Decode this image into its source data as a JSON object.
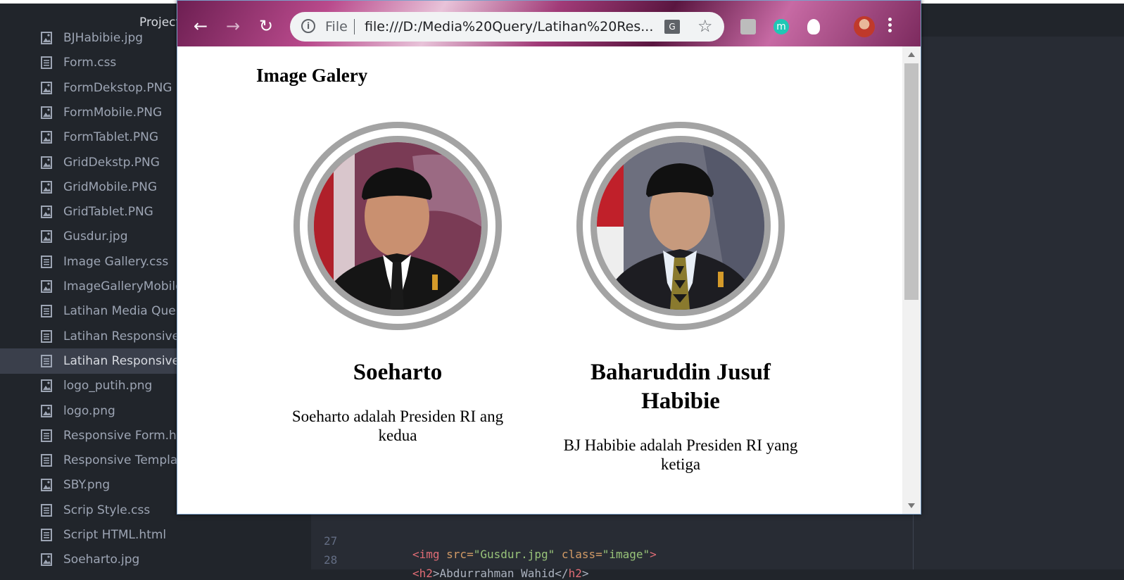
{
  "editor": {
    "tree_title": "Project",
    "files": [
      {
        "name": "BJHabibie.jpg",
        "type": "image"
      },
      {
        "name": "Form.css",
        "type": "file"
      },
      {
        "name": "FormDekstop.PNG",
        "type": "image"
      },
      {
        "name": "FormMobile.PNG",
        "type": "image"
      },
      {
        "name": "FormTablet.PNG",
        "type": "image"
      },
      {
        "name": "GridDekstp.PNG",
        "type": "image"
      },
      {
        "name": "GridMobile.PNG",
        "type": "image"
      },
      {
        "name": "GridTablet.PNG",
        "type": "image"
      },
      {
        "name": "Gusdur.jpg",
        "type": "image"
      },
      {
        "name": "Image Gallery.css",
        "type": "file"
      },
      {
        "name": "ImageGalleryMobile.",
        "type": "image"
      },
      {
        "name": "Latihan Media Query",
        "type": "file"
      },
      {
        "name": "Latihan Responsive A",
        "type": "file"
      },
      {
        "name": "Latihan Responsive In",
        "type": "file",
        "selected": true
      },
      {
        "name": "logo_putih.png",
        "type": "image"
      },
      {
        "name": "logo.png",
        "type": "image"
      },
      {
        "name": "Responsive Form.htm",
        "type": "file"
      },
      {
        "name": "Responsive Template",
        "type": "file"
      },
      {
        "name": "SBY.png",
        "type": "image"
      },
      {
        "name": "Scrip Style.css",
        "type": "file"
      },
      {
        "name": "Script HTML.html",
        "type": "file"
      },
      {
        "name": "Soeharto.jpg",
        "type": "image"
      }
    ],
    "code_lines": [
      {
        "num": "27",
        "tag_open": "<img",
        "attr1": " src=",
        "val1": "\"Gusdur.jpg\"",
        "attr2": " class=",
        "val2": "\"image\"",
        "tag_close": ">"
      },
      {
        "num": "28",
        "tag_open": "<h2",
        "text": ">Abdurrahman Wahid</",
        "tag_end": "h2",
        "tail": ">"
      }
    ]
  },
  "browser": {
    "omnibox_file": "File",
    "url": "file:///D:/Media%20Query/Latihan%20Res...",
    "translate_icon": "translate-icon",
    "star_icon": "bookmark-star-icon",
    "extension_m": "m",
    "page": {
      "title": "Image Galery",
      "cards": [
        {
          "name": "Soeharto",
          "desc": "Soeharto adalah Presiden RI ang kedua"
        },
        {
          "name": "Baharuddin Jusuf Habibie",
          "desc": "BJ Habibie adalah Presiden RI yang ketiga"
        }
      ]
    }
  },
  "colors": {
    "editor_bg": "#282c34",
    "tree_bg": "#21252b",
    "ring": "#a3a3a3"
  }
}
